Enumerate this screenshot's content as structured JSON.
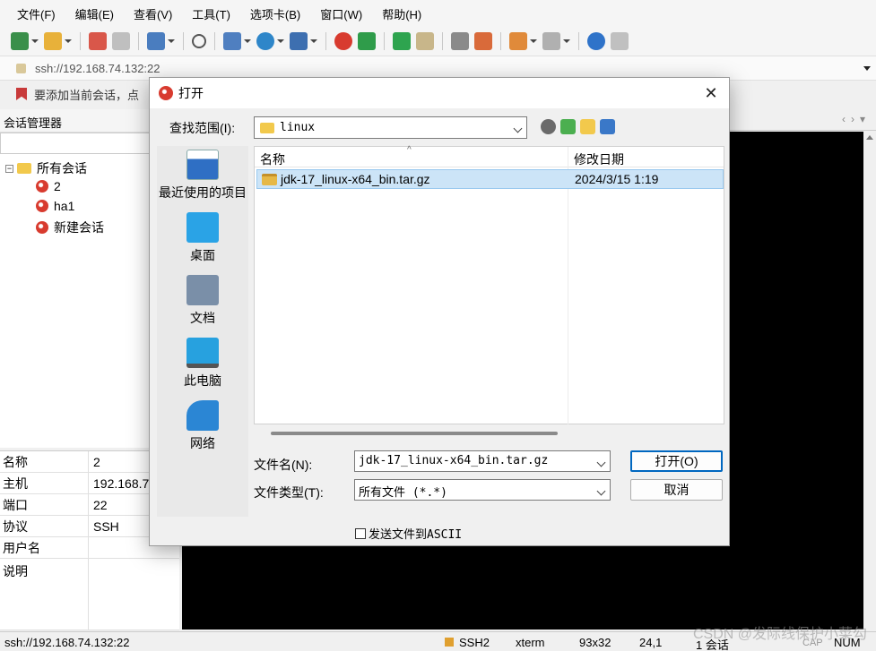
{
  "menu": [
    "文件(F)",
    "编辑(E)",
    "查看(V)",
    "工具(T)",
    "选项卡(B)",
    "窗口(W)",
    "帮助(H)"
  ],
  "toolbar_icons": [
    "new-session-icon",
    "open-folder-icon",
    "connect-icon",
    "disconnect-icon",
    "session-options-icon",
    "find-icon",
    "copy-icon",
    "globe-icon",
    "font-icon",
    "xshell-icon",
    "xftp-icon",
    "fullscreen-icon",
    "lock-icon",
    "keyboard-icon",
    "pen-icon",
    "new-tab-icon",
    "layout-icon",
    "help-icon",
    "chat-icon"
  ],
  "address": {
    "value": "ssh://192.168.74.132:22"
  },
  "hint": {
    "text": "要添加当前会话，点"
  },
  "session_manager": {
    "title": "会话管理器",
    "tree": [
      {
        "label": "所有会话",
        "level": 0
      },
      {
        "label": "2",
        "level": 1
      },
      {
        "label": "ha1",
        "level": 1
      },
      {
        "label": "新建会话",
        "level": 1
      }
    ],
    "props": [
      {
        "key": "名称",
        "value": "2"
      },
      {
        "key": "主机",
        "value": "192.168.7"
      },
      {
        "key": "端口",
        "value": "22"
      },
      {
        "key": "协议",
        "value": "SSH"
      },
      {
        "key": "用户名",
        "value": ""
      },
      {
        "key": "说明",
        "value": ""
      }
    ]
  },
  "statusbar": {
    "address": "ssh://192.168.74.132:22",
    "protocol": "SSH2",
    "term": "xterm",
    "size": "93x32",
    "cursor": "24,1",
    "sessions": "1 会话",
    "cap": "CAP",
    "num": "NUM"
  },
  "watermark": "CSDN @发际线保护小菜勾",
  "dialog": {
    "title": "打开",
    "close": "✕",
    "look_in_label": "查找范围(I):",
    "look_in_value": "linux",
    "places": [
      {
        "label": "最近使用的项目",
        "icon": "recent-icon",
        "color": "#2f6fc4"
      },
      {
        "label": "桌面",
        "icon": "desktop-icon",
        "color": "#2aa3e6"
      },
      {
        "label": "文档",
        "icon": "documents-icon",
        "color": "#7a8fa8"
      },
      {
        "label": "此电脑",
        "icon": "computer-icon",
        "color": "#27a1df"
      },
      {
        "label": "网络",
        "icon": "network-icon",
        "color": "#2b86d4"
      }
    ],
    "columns": {
      "name": "名称",
      "date": "修改日期"
    },
    "files": [
      {
        "name": "jdk-17_linux-x64_bin.tar.gz",
        "date": "2024/3/15 1:19"
      }
    ],
    "filename_label": "文件名(N):",
    "filename_value": "jdk-17_linux-x64_bin.tar.gz",
    "filetype_label": "文件类型(T):",
    "filetype_value": "所有文件 (*.*)",
    "open_button": "打开(O)",
    "cancel_button": "取消",
    "ascii_checkbox": "发送文件到ASCII"
  }
}
